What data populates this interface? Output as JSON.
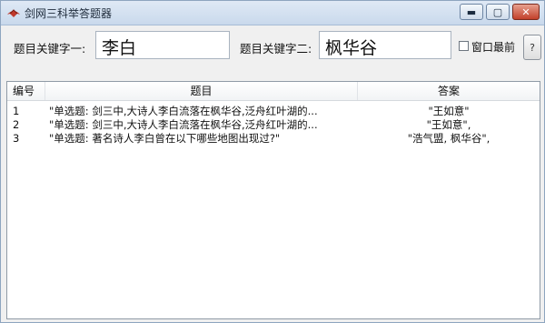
{
  "window": {
    "title": "剑网三科举答题器",
    "minimize_symbol": "▬",
    "maximize_symbol": "▢",
    "close_symbol": "✕"
  },
  "search": {
    "keyword1_label": "题目关键字一:",
    "keyword1_value": "李白",
    "keyword2_label": "题目关键字二:",
    "keyword2_value": "枫华谷",
    "topmost_label": "窗口最前",
    "topmost_checked": false,
    "help_label": "?"
  },
  "list": {
    "columns": [
      "编号",
      "题目",
      "答案"
    ],
    "rows": [
      {
        "id": "1",
        "question": "\"单选题: 剑三中,大诗人李白流落在枫华谷,泛舟红叶湖的...",
        "answer": "\"王如意\""
      },
      {
        "id": "2",
        "question": "\"单选题: 剑三中,大诗人李白流落在枫华谷,泛舟红叶湖的...",
        "answer": "\"王如意\","
      },
      {
        "id": "3",
        "question": "\"单选题: 著名诗人李白曾在以下哪些地图出现过?\"",
        "answer": "\"浩气盟, 枫华谷\","
      }
    ]
  },
  "colors": {
    "titlebar": "#c9d9ec",
    "close_button": "#c2402a",
    "window_bg": "#f0f0f0"
  }
}
